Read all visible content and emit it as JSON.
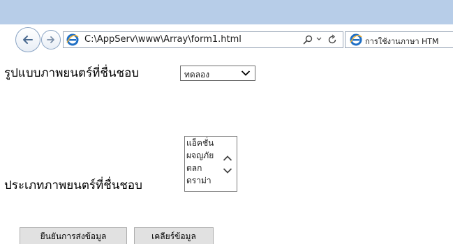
{
  "browser": {
    "address": "C:\\AppServ\\www\\Array\\form1.html",
    "tab_title": "การใช้งานภาษา HTM",
    "icons": {
      "back": "back-arrow-icon",
      "forward": "forward-arrow-icon",
      "page": "ie-logo-icon",
      "search": "search-icon",
      "refresh": "refresh-icon"
    },
    "colors": {
      "titlebar": "#b7cde8",
      "ie_blue": "#1f6fc5",
      "ie_ring": "#f0b030"
    }
  },
  "form": {
    "row1_label": "รูปแบบภาพยนตร์ที่ชื่นชอบ",
    "select_value": "ทดลอง",
    "row2_label": "ประเภทภาพยนตร์ที่ชื่นชอบ",
    "list_options": [
      "แอ็คชั่น",
      "ผจญภัย",
      "ตลก",
      "ดราม่า"
    ],
    "submit_label": "ยืนยันการส่งข้อมูล",
    "reset_label": "เคลียร์ข้อมูล"
  }
}
